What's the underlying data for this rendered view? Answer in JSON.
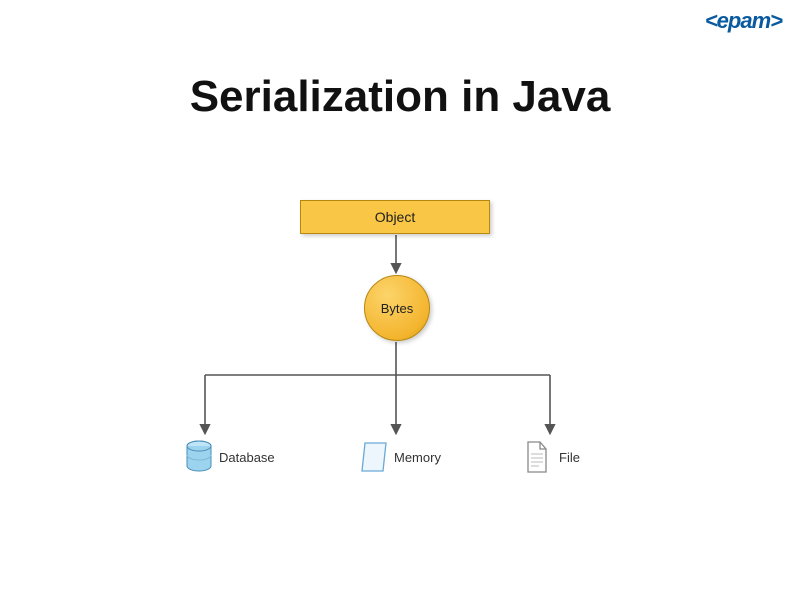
{
  "logo_text": "<epam>",
  "title": "Serialization in Java",
  "diagram": {
    "object_label": "Object",
    "bytes_label": "Bytes",
    "destinations": {
      "database": "Database",
      "memory": "Memory",
      "file": "File"
    }
  },
  "colors": {
    "accent": "#f9c645",
    "accent_border": "#b5880f",
    "logo": "#0a5a9f",
    "arrow": "#555555"
  }
}
